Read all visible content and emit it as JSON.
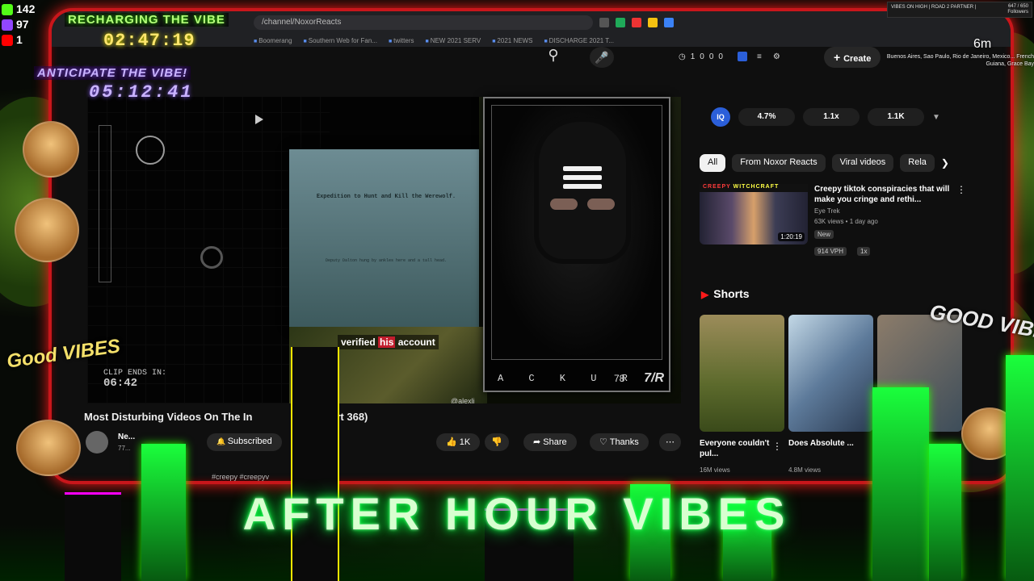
{
  "overlay": {
    "social": [
      {
        "icon": "kick-icon",
        "color": "#53fc18",
        "count": "142"
      },
      {
        "icon": "twitch-icon",
        "color": "#9146ff",
        "count": "97"
      },
      {
        "icon": "youtube-icon",
        "color": "#ff0000",
        "count": "1"
      }
    ],
    "recharge_title": "RECHARGING THE VIBE",
    "recharge_timer": "02:47:19",
    "anticipate_title": "ANTICIPATE THE VIBE!",
    "anticipate_timer": "05:12:41",
    "clip_label": "CLIP ENDS IN:",
    "clip_time": "06:42",
    "ribbon_left": "VIBES ON HIGH | ROAD 2 PARTNER |",
    "ribbon_right_1": "647 / 650",
    "ribbon_right_2": "Followers",
    "countdown": "6m",
    "cities": "Buenos Aires, Sao Paulo, Rio de Janeiro, Mexico... French Guiana, Grace Bay",
    "marquee": "AFTER HOUR VIBES",
    "good_vibes_left": "Good VIBES",
    "good_vibes_right": "GOOD VIBES"
  },
  "browser": {
    "url": "/channel/NoxorReacts",
    "bookmarks": [
      "Boomerang",
      "Southern Web for Fan...",
      "twitters",
      "NEW 2021 SERV",
      "2021 NEWS",
      "DISCHARGE 2021 T..."
    ],
    "header_stats": [
      "1",
      "0",
      "0",
      "0"
    ],
    "create_label": "Create"
  },
  "video": {
    "doc_heading": "Expedition to Hunt and Kill the Werewolf.",
    "doc_body": "Deputy Dalton hung by ankles here and a tall head.",
    "caption_pre": "verified",
    "caption_highlight": "his",
    "caption_post": "account",
    "watermark": "@alexli",
    "cam_label": "A C K U R",
    "cam_number": "78",
    "cam_logo": "7/R",
    "title_main": "Most Disturbing Videos On The In",
    "title_part": "(Part 368)",
    "channel_name": "Ne...",
    "channel_subs": "77...",
    "subscribed_label": "Subscribed",
    "likes": "1K",
    "share_label": "Share",
    "thanks_label": "Thanks",
    "hashtags": "#creepy #creepyv"
  },
  "sidebar": {
    "stat_badge": "IQ",
    "stats": [
      "4.7%",
      "1.1x",
      "1.1K"
    ],
    "chips": [
      {
        "label": "All",
        "active": true
      },
      {
        "label": "From Noxor Reacts",
        "active": false
      },
      {
        "label": "Viral videos",
        "active": false
      },
      {
        "label": "Rela",
        "active": false
      }
    ],
    "rec": {
      "banner_a": "CREEPY",
      "banner_b": "WITCHCRAFT",
      "duration": "1:20:19",
      "title": "Creepy tiktok conspiracies that will make you cringe and rethi...",
      "channel": "Eye Trek",
      "meta": "63K views • 1 day ago",
      "badge1": "New",
      "badge2": "914 VPH",
      "badge3": "1x"
    },
    "shorts_label": "Shorts",
    "shorts": [
      {
        "title": "Everyone couldn't pul...",
        "views": "16M views"
      },
      {
        "title": "Does Absolute ...",
        "views": "4.8M views"
      }
    ]
  }
}
